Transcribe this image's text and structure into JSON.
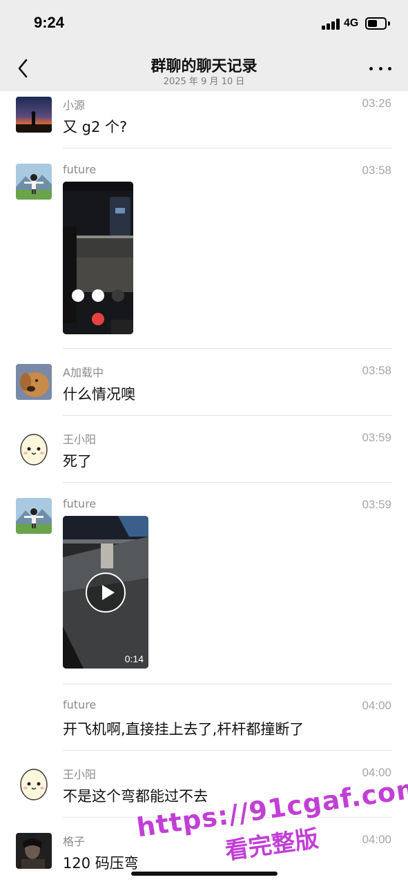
{
  "status_bar": {
    "time": "9:24",
    "network": "4G"
  },
  "nav": {
    "title": "群聊的聊天记录",
    "subtitle": "2025 年 9 月 10 日"
  },
  "messages": [
    {
      "sender": "小源",
      "time": "03:26",
      "text": "又 g2 个?",
      "avatar": "sunset-avatar"
    },
    {
      "sender": "future",
      "time": "03:58",
      "type": "image",
      "avatar": "anime-boy-avatar"
    },
    {
      "sender": "A加载中",
      "time": "03:58",
      "text": "什么情况噢",
      "avatar": "dog-avatar"
    },
    {
      "sender": "王小阳",
      "time": "03:59",
      "text": "死了",
      "avatar": "egg-avatar"
    },
    {
      "sender": "future",
      "time": "03:59",
      "type": "video",
      "duration": "0:14",
      "avatar": "anime-boy-avatar"
    },
    {
      "sender": "future",
      "time": "04:00",
      "text": "开飞机啊,直接挂上去了,杆杆都撞断了"
    },
    {
      "sender": "王小阳",
      "time": "04:00",
      "text": "不是这个弯都能过不去",
      "avatar": "egg-avatar"
    },
    {
      "sender": "格子",
      "time": "04:00",
      "text": "120 码压弯",
      "avatar": "dark-portrait-avatar"
    }
  ],
  "watermark": {
    "line1": "https://91cgaf.com",
    "line2": "看完整版"
  }
}
